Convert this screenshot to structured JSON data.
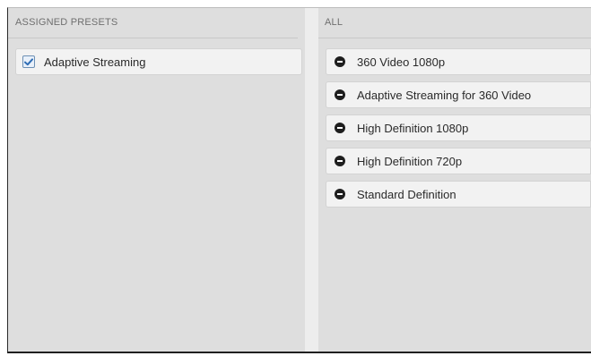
{
  "assigned": {
    "header": "ASSIGNED PRESETS",
    "items": [
      {
        "label": "Adaptive Streaming",
        "checked": true
      }
    ]
  },
  "all": {
    "header": "ALL",
    "items": [
      {
        "label": "360 Video 1080p"
      },
      {
        "label": "Adaptive Streaming for 360 Video"
      },
      {
        "label": "High Definition 1080p"
      },
      {
        "label": "High Definition 720p"
      },
      {
        "label": "Standard Definition"
      }
    ]
  },
  "colors": {
    "panel_bg": "#dedede",
    "item_bg": "#f2f2f2",
    "check_color": "#2f6db5",
    "remove_icon": "#1e1e1e"
  }
}
